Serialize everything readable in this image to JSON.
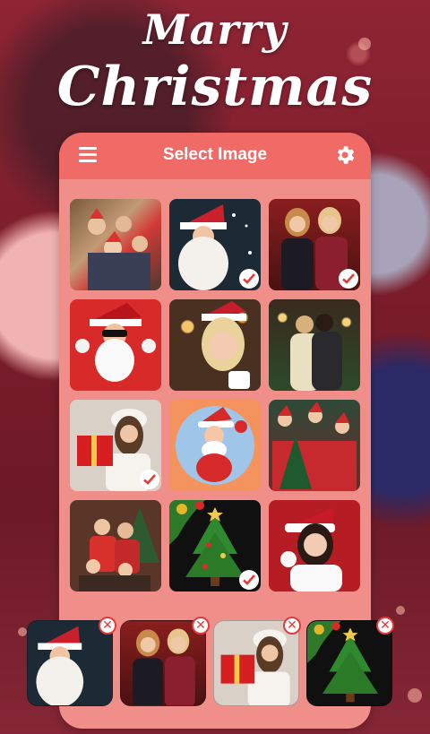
{
  "title": {
    "line1": "Marry",
    "line2": "Christmas"
  },
  "header": {
    "title": "Select Image",
    "menu_icon": "hamburger-menu-icon",
    "settings_icon": "gear-icon"
  },
  "colors": {
    "header": "#f06a66",
    "card": "#f08e8a",
    "check": "#e23b3b",
    "remove": "#e23b3b"
  },
  "grid": {
    "images": [
      {
        "name": "christmas-friends-selfie-photo",
        "selected": false
      },
      {
        "name": "santa-snow-photo",
        "selected": true
      },
      {
        "name": "two-women-christmas-photo",
        "selected": true
      },
      {
        "name": "santa-sunglasses-photo",
        "selected": false
      },
      {
        "name": "blonde-santa-hat-photo",
        "selected": false
      },
      {
        "name": "couple-hugging-tree-photo",
        "selected": false
      },
      {
        "name": "woman-gift-photo",
        "selected": true
      },
      {
        "name": "cartoon-santa-photo",
        "selected": false
      },
      {
        "name": "santa-crowd-photo",
        "selected": false
      },
      {
        "name": "family-tree-photo",
        "selected": false
      },
      {
        "name": "christmas-tree-photo",
        "selected": true
      },
      {
        "name": "woman-santa-costume-photo",
        "selected": false
      }
    ]
  },
  "selected_tray": [
    {
      "name": "santa-snow-photo"
    },
    {
      "name": "two-women-christmas-photo"
    },
    {
      "name": "woman-gift-photo"
    },
    {
      "name": "christmas-tree-photo"
    }
  ]
}
